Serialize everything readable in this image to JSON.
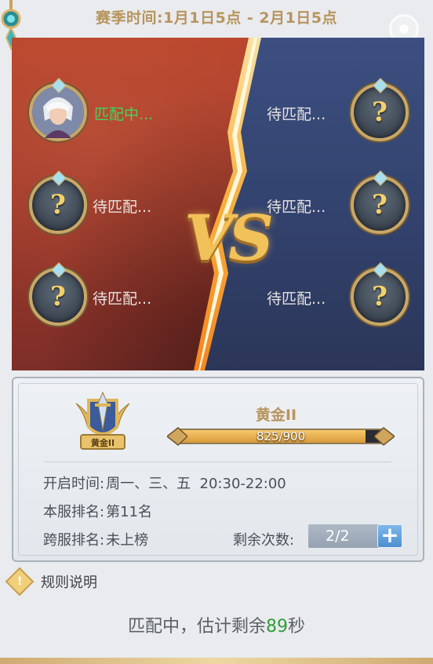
{
  "season": {
    "label": "赛季时间:",
    "range": "1月1日5点 - 2月1日5点"
  },
  "arena": {
    "vs_text": "VS",
    "left_slots": [
      {
        "status": "匹配中...",
        "filled": true
      },
      {
        "status": "待匹配...",
        "filled": false
      },
      {
        "status": "待匹配...",
        "filled": false
      }
    ],
    "right_slots": [
      {
        "status": "待匹配...",
        "filled": false
      },
      {
        "status": "待匹配...",
        "filled": false
      },
      {
        "status": "待匹配...",
        "filled": false
      }
    ],
    "unknown_symbol": "?"
  },
  "rank": {
    "badge_label": "黄金II",
    "name": "黄金II",
    "progress_text": "825/900",
    "progress_current": 825,
    "progress_max": 900
  },
  "info": {
    "open_time_label": "开启时间:",
    "open_time_value": "周一、三、五  20:30-22:00",
    "server_rank_label": "本服排名:",
    "server_rank_value": "第11名",
    "cross_rank_label": "跨服排名:",
    "cross_rank_value": "未上榜",
    "remaining_label": "剩余次数:",
    "remaining_value": "2/2",
    "plus_symbol": "+"
  },
  "rules": {
    "icon_symbol": "!",
    "label": "规则说明"
  },
  "status": {
    "prefix": "匹配中，估计剩余",
    "seconds": "89",
    "suffix": "秒"
  },
  "colors": {
    "accent_gold": "#b8945d",
    "active_green": "#45d35a",
    "countdown_green": "#2e9f36",
    "plus_blue": "#4d8fd0"
  },
  "icons": {
    "settings": "settings-icon",
    "question": "question-mark-icon",
    "plus": "plus-icon",
    "rules": "rules-info-icon",
    "rank_badge": "gold-rank-badge-icon"
  }
}
